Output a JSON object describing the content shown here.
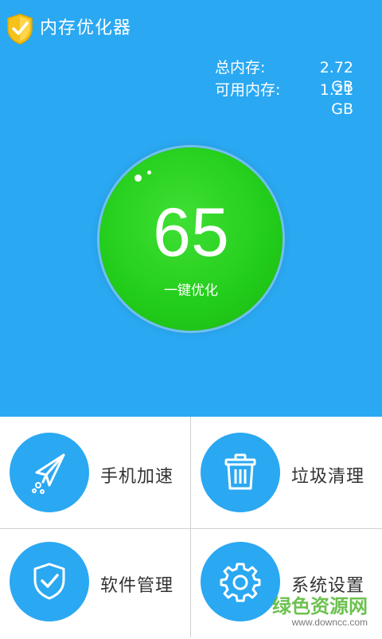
{
  "header": {
    "app_title": "内存优化器",
    "app_icon": "shield-check-icon"
  },
  "memory": {
    "total_label": "总内存:",
    "total_value": "2.72 GB",
    "available_label": "可用内存:",
    "available_value": "1.21 GB"
  },
  "optimizer": {
    "score": "65",
    "button_label": "一键优化"
  },
  "tiles": [
    {
      "label": "手机加速",
      "icon": "paper-plane-icon"
    },
    {
      "label": "垃圾清理",
      "icon": "trash-bin-icon"
    },
    {
      "label": "软件管理",
      "icon": "shield-check-icon"
    },
    {
      "label": "系统设置",
      "icon": "gear-icon"
    }
  ],
  "watermark": {
    "main": "绿色资源网",
    "sub": "www.downcc.com"
  },
  "colors": {
    "primary": "#2aa8f2",
    "orb_green": "#22cc1a",
    "badge_yellow": "#f4c21b"
  }
}
